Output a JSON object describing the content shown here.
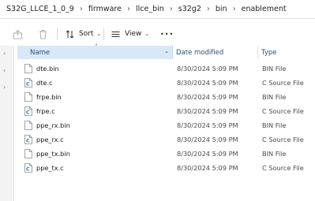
{
  "breadcrumb": [
    "S32G_LLCE_1_0_9",
    "firmware",
    "llce_bin",
    "s32g2",
    "bin",
    "enablement"
  ],
  "toolbar": {
    "sort_label": "Sort",
    "view_label": "View",
    "more_label": "•••"
  },
  "columns": {
    "name": "Name",
    "date": "Date modified",
    "type": "Type"
  },
  "icons": {
    "sort_arrow": "˄",
    "chevron": "⌄"
  },
  "files": [
    {
      "name": "dte.bin",
      "date": "8/30/2024 5:09 PM",
      "type": "BIN File",
      "icon": "bin-file-icon"
    },
    {
      "name": "dte.c",
      "date": "8/30/2024 5:09 PM",
      "type": "C Source File",
      "icon": "c-file-icon"
    },
    {
      "name": "frpe.bin",
      "date": "8/30/2024 5:09 PM",
      "type": "BIN File",
      "icon": "bin-file-icon"
    },
    {
      "name": "frpe.c",
      "date": "8/30/2024 5:09 PM",
      "type": "C Source File",
      "icon": "c-file-icon"
    },
    {
      "name": "ppe_rx.bin",
      "date": "8/30/2024 5:09 PM",
      "type": "BIN File",
      "icon": "bin-file-icon"
    },
    {
      "name": "ppe_rx.c",
      "date": "8/30/2024 5:09 PM",
      "type": "C Source File",
      "icon": "c-file-icon"
    },
    {
      "name": "ppe_tx.bin",
      "date": "8/30/2024 5:09 PM",
      "type": "BIN File",
      "icon": "bin-file-icon"
    },
    {
      "name": "ppe_tx.c",
      "date": "8/30/2024 5:09 PM",
      "type": "C Source File",
      "icon": "c-file-icon"
    }
  ],
  "colors": {
    "header_selected": "#d9e8f7",
    "header_text": "#2a4f75",
    "c_icon": "#2a70c0"
  }
}
